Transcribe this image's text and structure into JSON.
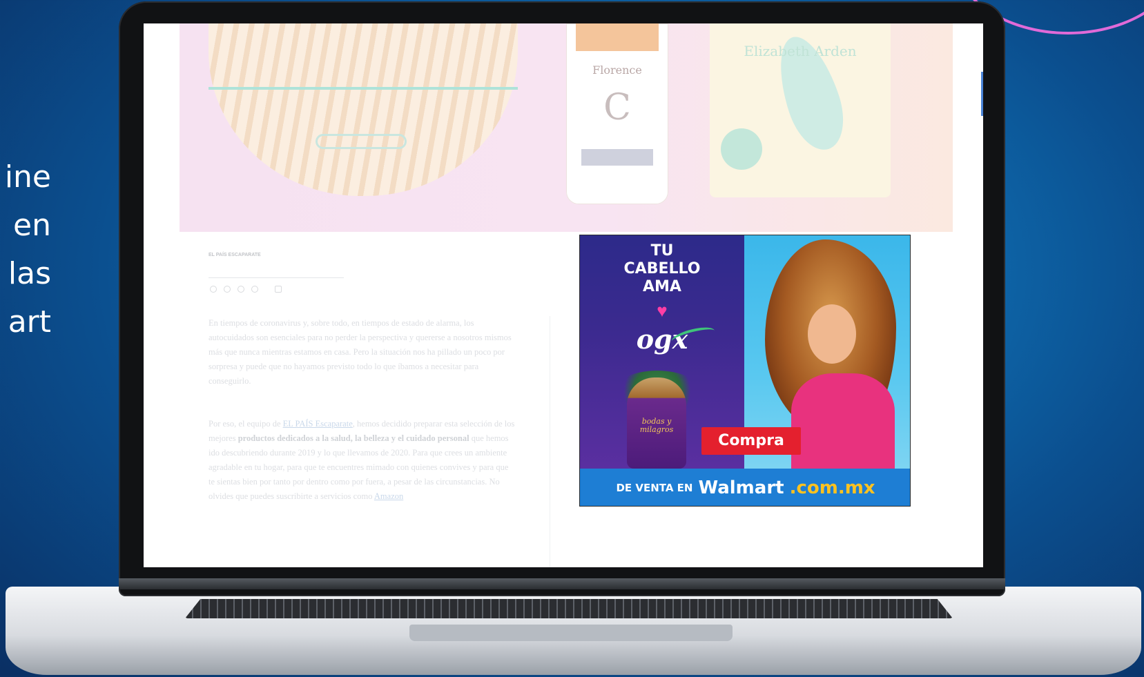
{
  "colors": {
    "accent_ring": "#e06ad8",
    "cta_red": "#e4202e",
    "walmart_blue": "#1e7ed4",
    "walmart_yellow": "#ffc220"
  },
  "side_text": [
    "ine",
    "en",
    "las",
    "art"
  ],
  "hero": {
    "bottle_brand": "Florence",
    "bottle_letter": "C",
    "box_brand": "Elizabeth Arden"
  },
  "article": {
    "kicker": "EL PAÍS ESCAPARATE",
    "paragraph_1": "En tiempos de coronavirus y, sobre todo, en tiempos de estado de alarma, los autocuidados son esenciales para no perder la perspectiva y quererse a nosotros mismos más que nunca mientras estamos en casa. Pero la situación nos ha pillado un poco por sorpresa y puede que no hayamos previsto todo lo que íbamos a necesitar para conseguirlo.",
    "paragraph_2_prefix": "Por eso, el equipo de",
    "paragraph_2_link": "EL PAÍS Escaparate",
    "paragraph_2_mid": ", hemos decidido preparar esta selección de los mejores",
    "paragraph_2_bold": "productos dedicados a la salud, la belleza y el cuidado personal",
    "paragraph_2_suffix": "que hemos ido descubriendo durante 2019 y lo que llevamos de 2020. Para que crees un ambiente agradable en tu hogar, para que te encuentres mimado con quienes convives y para que te sientas bien por tanto por dentro como por fuera, a pesar de las circunstancias. No olvides que puedes suscribirte a servicios como",
    "paragraph_2_link_2": "Amazon"
  },
  "ad": {
    "headline_1": "TU",
    "headline_2": "CABELLO",
    "headline_3": "AMA",
    "heart": "♥",
    "logo": "ogx",
    "bottle_label": "bodas y milagros",
    "cta_label": "Compra",
    "footer_prefix": "DE VENTA EN",
    "footer_brand": "Walmart",
    "footer_tld": ".com.mx"
  }
}
